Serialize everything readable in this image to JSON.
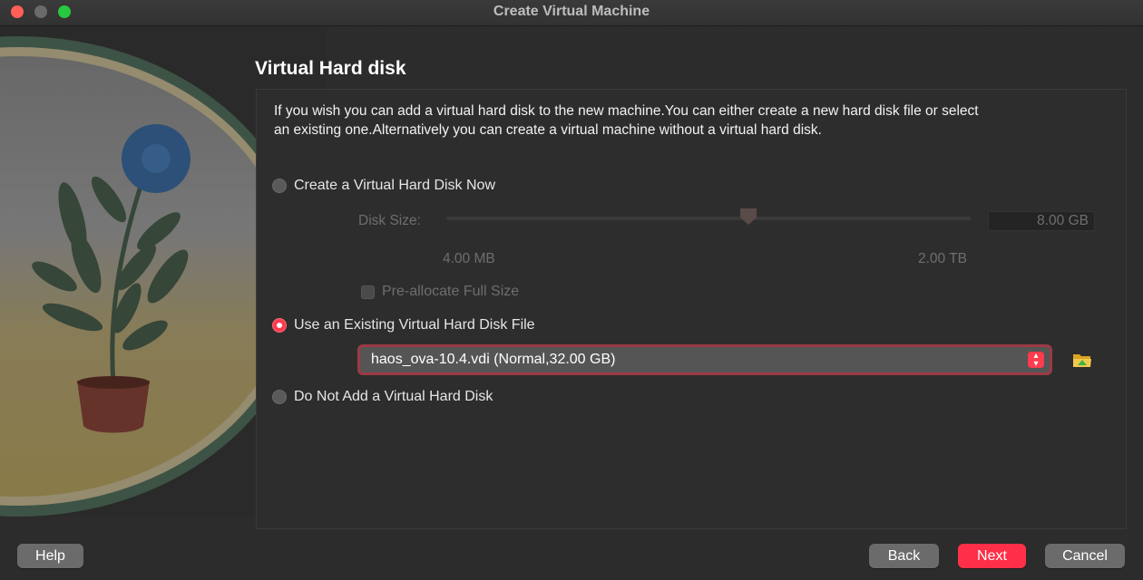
{
  "window": {
    "title": "Create Virtual Machine"
  },
  "page": {
    "title": "Virtual Hard disk",
    "description": "If you wish you can add a virtual hard disk to the new machine.You can either create a new hard disk file or select an existing one.Alternatively you can create a virtual machine without a virtual hard disk."
  },
  "options": {
    "create_now": {
      "label": "Create a Virtual Hard Disk Now",
      "selected": false
    },
    "disk_size": {
      "label": "Disk Size:",
      "value": "8.00 GB",
      "min_label": "4.00 MB",
      "max_label": "2.00 TB",
      "slider_level": 0.57
    },
    "preallocate": {
      "label": "Pre-allocate Full Size",
      "checked": false
    },
    "use_existing": {
      "label": "Use an Existing Virtual Hard Disk File",
      "selected": true
    },
    "existing_file": {
      "value": "haos_ova-10.4.vdi (Normal,32.00 GB)"
    },
    "no_disk": {
      "label": "Do Not Add a Virtual Hard Disk",
      "selected": false
    }
  },
  "buttons": {
    "help": "Help",
    "back": "Back",
    "next": "Next",
    "cancel": "Cancel"
  },
  "icons": {
    "folder": "folder-open-icon",
    "combo_arrow": "updown-chevron-icon"
  },
  "colors": {
    "accent": "#ff3b4e",
    "window_bg": "#2c2c2c"
  }
}
